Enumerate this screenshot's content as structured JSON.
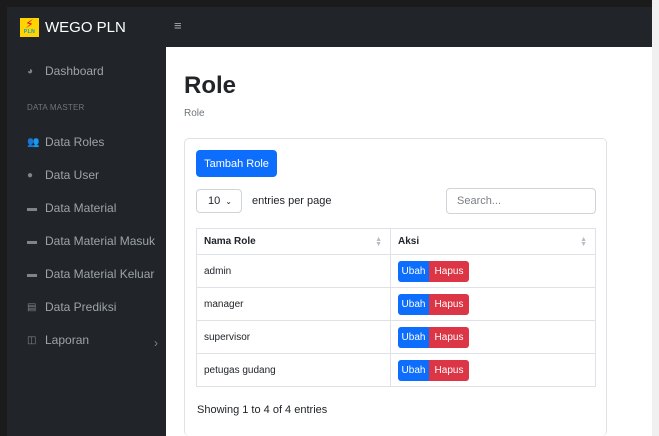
{
  "brand": {
    "name": "WEGO PLN",
    "logo_text": "PLN"
  },
  "sidebar": {
    "dashboard": "Dashboard",
    "heading": "DATA MASTER",
    "items": [
      {
        "label": "Data Roles",
        "icon": "users-icon"
      },
      {
        "label": "Data User",
        "icon": "user-icon"
      },
      {
        "label": "Data Material",
        "icon": "table-icon"
      },
      {
        "label": "Data Material Masuk",
        "icon": "table-icon"
      },
      {
        "label": "Data Material Keluar",
        "icon": "table-icon"
      },
      {
        "label": "Data Prediksi",
        "icon": "book-icon"
      },
      {
        "label": "Laporan",
        "icon": "columns-icon"
      }
    ]
  },
  "topbar": {
    "menu_icon": "hamburger-icon"
  },
  "page": {
    "title": "Role",
    "breadcrumb": "Role"
  },
  "card": {
    "add_button": "Tambah Role",
    "per_page_value": "10",
    "per_page_label": "entries per page",
    "search_placeholder": "Search...",
    "columns": [
      "Nama Role",
      "Aksi"
    ],
    "rows": [
      {
        "name": "admin"
      },
      {
        "name": "manager"
      },
      {
        "name": "supervisor"
      },
      {
        "name": "petugas gudang"
      }
    ],
    "edit_label": "Ubah",
    "delete_label": "Hapus",
    "info": "Showing 1 to 4 of 4 entries"
  },
  "colors": {
    "primary": "#0d6efd",
    "danger": "#dc3545",
    "sidebar": "#212529"
  }
}
